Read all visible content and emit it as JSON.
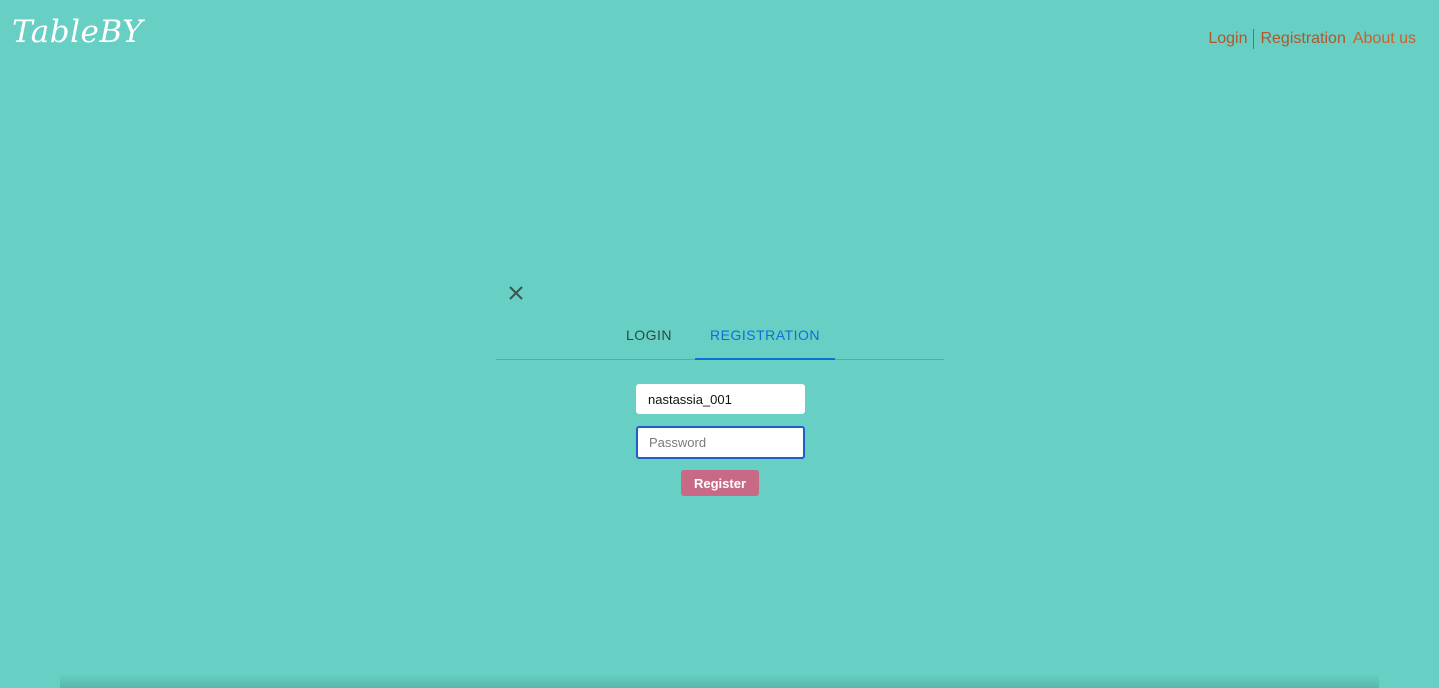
{
  "app": {
    "logo_text": "TableBY"
  },
  "topnav": {
    "login": "Login",
    "registration": "Registration",
    "about": "About us"
  },
  "modal": {
    "close_icon": "close-icon",
    "tabs": [
      {
        "label": "LOGIN",
        "active": false
      },
      {
        "label": "REGISTRATION",
        "active": true
      }
    ],
    "username": {
      "value": "nastassia_001"
    },
    "password": {
      "value": "",
      "placeholder": "Password"
    },
    "register_label": "Register"
  },
  "colors": {
    "background": "#67cfc3",
    "nav_link": "#b5552a",
    "active_tab": "#0c70d8",
    "register_button": "#c86a86"
  }
}
